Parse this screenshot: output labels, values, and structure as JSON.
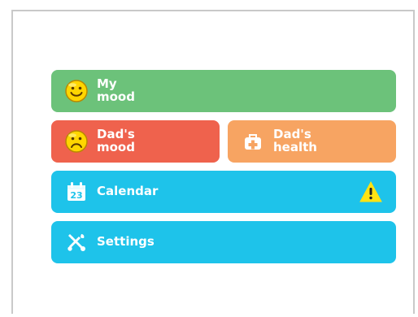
{
  "menu": {
    "my_mood": {
      "label": "My\nmood",
      "icon": "smiling-face-icon"
    },
    "dads_mood": {
      "label": "Dad's\nmood",
      "icon": "sad-face-icon"
    },
    "dads_health": {
      "label": "Dad's\nhealth",
      "icon": "medical-bag-icon"
    },
    "calendar": {
      "label": "Calendar",
      "icon": "calendar-icon",
      "day": "23",
      "alert_icon": "warning-icon"
    },
    "settings": {
      "label": "Settings",
      "icon": "tools-icon"
    }
  },
  "colors": {
    "green": "#6cc27a",
    "red": "#ef624d",
    "orange": "#f7a462",
    "blue": "#1ec3ea",
    "warning_yellow": "#ffe313"
  }
}
